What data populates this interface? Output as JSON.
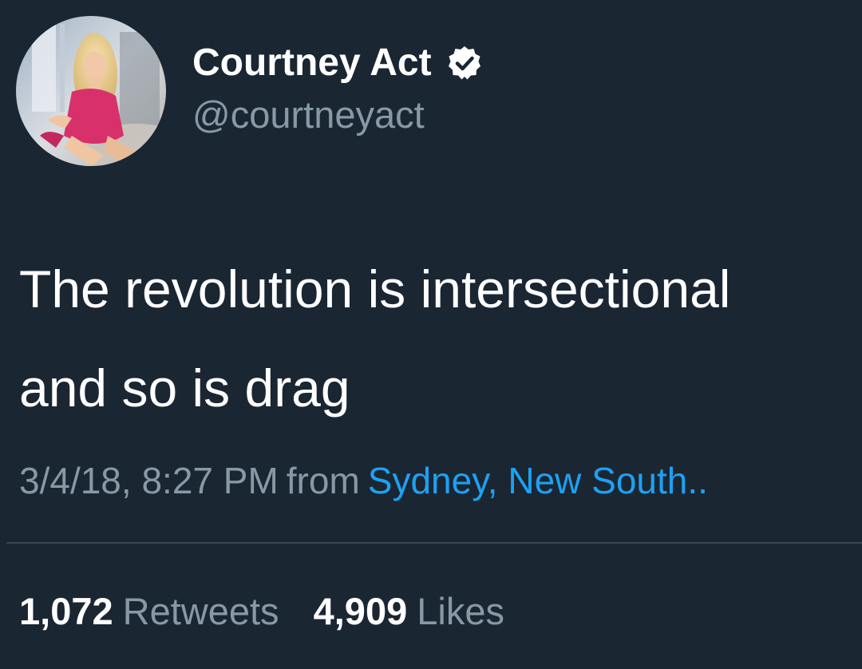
{
  "tweet": {
    "author": {
      "display_name": "Courtney Act",
      "handle": "@courtneyact",
      "verified": true,
      "avatar_icon": "profile-photo"
    },
    "text_lines": [
      "The revolution is intersectional",
      "and so is drag"
    ],
    "timestamp": "3/4/18, 8:27 PM",
    "from_word": "from",
    "location": "Sydney, New South..",
    "stats": {
      "retweets_count": "1,072",
      "retweets_label": "Retweets",
      "likes_count": "4,909",
      "likes_label": "Likes"
    }
  },
  "colors": {
    "background": "#1b2633",
    "primary_text": "#ffffff",
    "secondary_text": "#8899a6",
    "link": "#1da1f2",
    "divider": "#3a4653"
  }
}
